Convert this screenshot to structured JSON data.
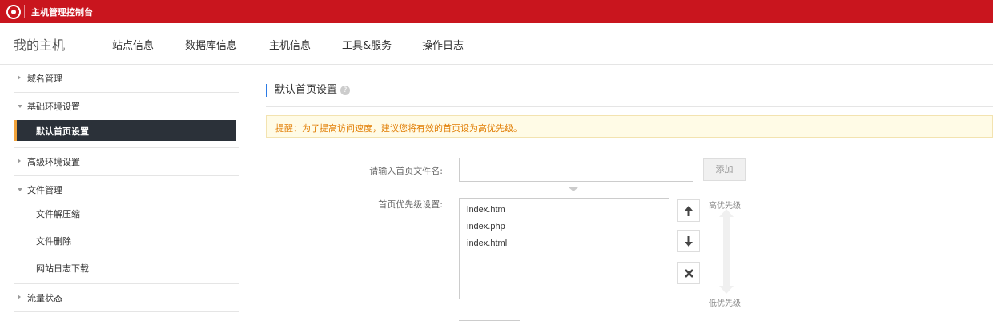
{
  "topbar": {
    "title": "主机管理控制台"
  },
  "navbar": {
    "brand": "我的主机",
    "items": [
      "站点信息",
      "数据库信息",
      "主机信息",
      "工具&服务",
      "操作日志"
    ]
  },
  "sidebar": {
    "groups": [
      {
        "label": "域名管理",
        "expanded": false
      },
      {
        "label": "基础环境设置",
        "expanded": true,
        "children": [
          {
            "label": "默认首页设置",
            "active": true
          }
        ]
      },
      {
        "label": "高级环境设置",
        "expanded": false
      },
      {
        "label": "文件管理",
        "expanded": true,
        "children": [
          {
            "label": "文件解压缩"
          },
          {
            "label": "文件删除"
          },
          {
            "label": "网站日志下载"
          }
        ]
      },
      {
        "label": "流量状态",
        "expanded": false
      }
    ]
  },
  "main": {
    "section_title": "默认首页设置",
    "notice": "提醒：为了提高访问速度，建议您将有效的首页设为高优先级。",
    "filename_label": "请输入首页文件名:",
    "filename_value": "",
    "add_button": "添加",
    "priority_label": "首页优先级设置:",
    "pages": [
      "index.htm",
      "index.php",
      "index.html"
    ],
    "high_priority": "高优先级",
    "low_priority": "低优先级"
  },
  "colors": {
    "topbar": "#c9151e",
    "active_item": "#2b3139",
    "accent": "#f2a33a",
    "notice_text": "#e07b00"
  },
  "icons": [
    "logo-icon",
    "help-icon",
    "move-up-icon",
    "move-down-icon",
    "delete-icon"
  ]
}
